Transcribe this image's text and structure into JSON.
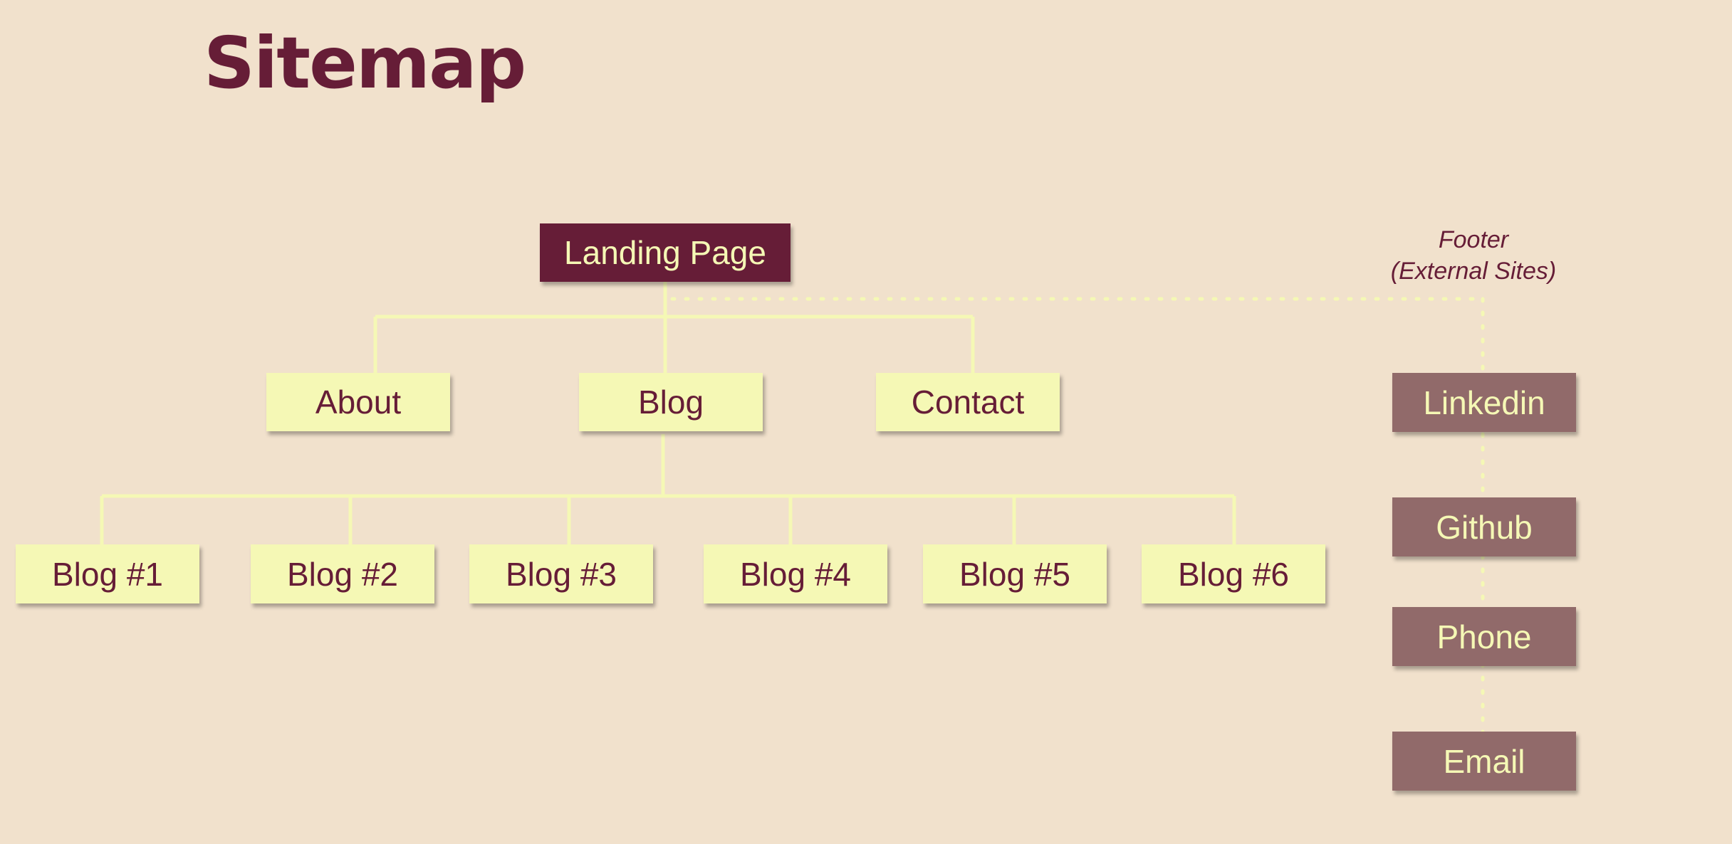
{
  "title": "Sitemap",
  "colors": {
    "background": "#f1e1cc",
    "brand": "#661d37",
    "node_fill": "#f5f8b5",
    "external_fill": "#916a6a",
    "connector": "#f5f8b5"
  },
  "root": {
    "label": "Landing Page"
  },
  "pages": [
    {
      "label": "About"
    },
    {
      "label": "Blog"
    },
    {
      "label": "Contact"
    }
  ],
  "blog_posts": [
    {
      "label": "Blog #1"
    },
    {
      "label": "Blog #2"
    },
    {
      "label": "Blog #3"
    },
    {
      "label": "Blog #4"
    },
    {
      "label": "Blog #5"
    },
    {
      "label": "Blog #6"
    }
  ],
  "footer": {
    "label_line1": "Footer",
    "label_line2": "(External Sites)",
    "links": [
      {
        "label": "Linkedin"
      },
      {
        "label": "Github"
      },
      {
        "label": "Phone"
      },
      {
        "label": "Email"
      }
    ]
  }
}
